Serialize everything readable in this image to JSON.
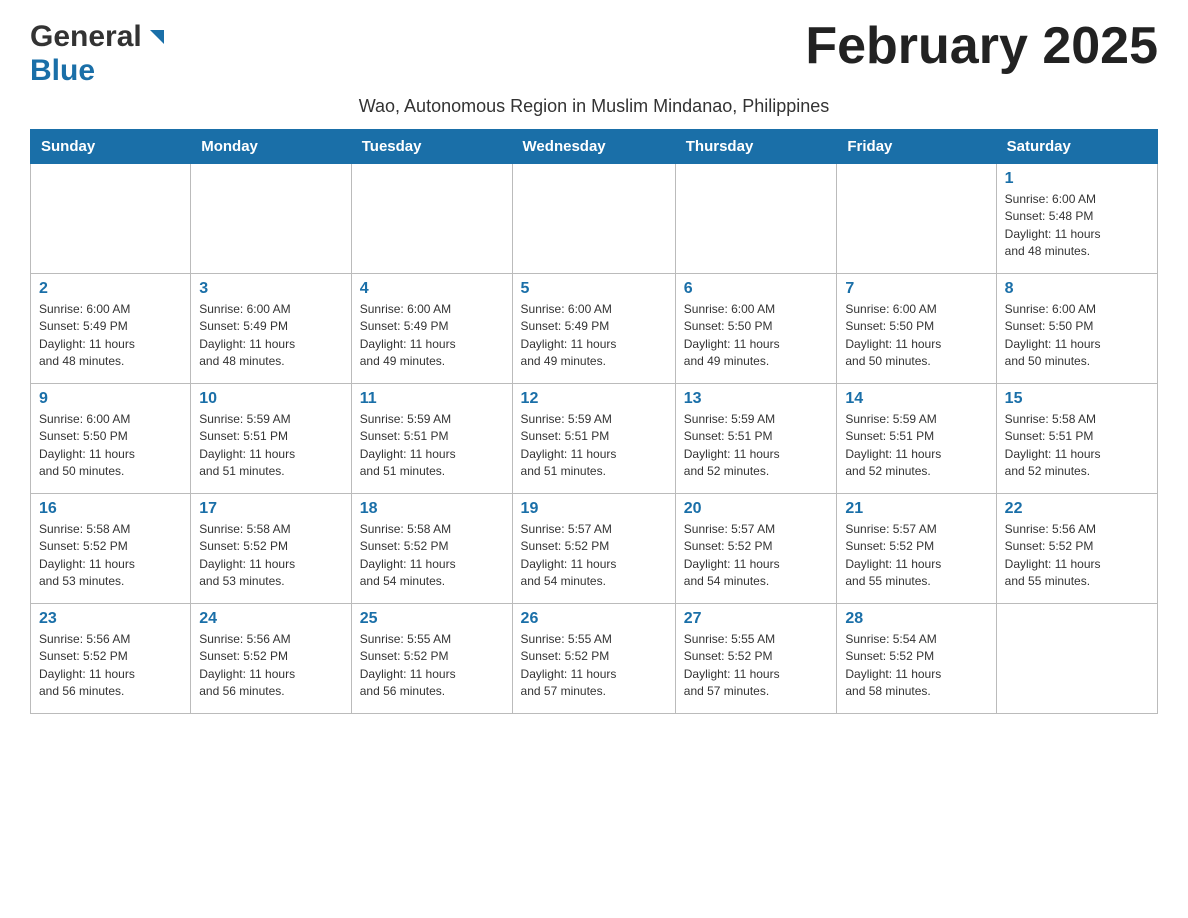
{
  "header": {
    "logo_general": "General",
    "logo_blue": "Blue",
    "month_title": "February 2025",
    "subtitle": "Wao, Autonomous Region in Muslim Mindanao, Philippines"
  },
  "weekdays": [
    "Sunday",
    "Monday",
    "Tuesday",
    "Wednesday",
    "Thursday",
    "Friday",
    "Saturday"
  ],
  "weeks": [
    [
      {
        "day": "",
        "info": ""
      },
      {
        "day": "",
        "info": ""
      },
      {
        "day": "",
        "info": ""
      },
      {
        "day": "",
        "info": ""
      },
      {
        "day": "",
        "info": ""
      },
      {
        "day": "",
        "info": ""
      },
      {
        "day": "1",
        "info": "Sunrise: 6:00 AM\nSunset: 5:48 PM\nDaylight: 11 hours\nand 48 minutes."
      }
    ],
    [
      {
        "day": "2",
        "info": "Sunrise: 6:00 AM\nSunset: 5:49 PM\nDaylight: 11 hours\nand 48 minutes."
      },
      {
        "day": "3",
        "info": "Sunrise: 6:00 AM\nSunset: 5:49 PM\nDaylight: 11 hours\nand 48 minutes."
      },
      {
        "day": "4",
        "info": "Sunrise: 6:00 AM\nSunset: 5:49 PM\nDaylight: 11 hours\nand 49 minutes."
      },
      {
        "day": "5",
        "info": "Sunrise: 6:00 AM\nSunset: 5:49 PM\nDaylight: 11 hours\nand 49 minutes."
      },
      {
        "day": "6",
        "info": "Sunrise: 6:00 AM\nSunset: 5:50 PM\nDaylight: 11 hours\nand 49 minutes."
      },
      {
        "day": "7",
        "info": "Sunrise: 6:00 AM\nSunset: 5:50 PM\nDaylight: 11 hours\nand 50 minutes."
      },
      {
        "day": "8",
        "info": "Sunrise: 6:00 AM\nSunset: 5:50 PM\nDaylight: 11 hours\nand 50 minutes."
      }
    ],
    [
      {
        "day": "9",
        "info": "Sunrise: 6:00 AM\nSunset: 5:50 PM\nDaylight: 11 hours\nand 50 minutes."
      },
      {
        "day": "10",
        "info": "Sunrise: 5:59 AM\nSunset: 5:51 PM\nDaylight: 11 hours\nand 51 minutes."
      },
      {
        "day": "11",
        "info": "Sunrise: 5:59 AM\nSunset: 5:51 PM\nDaylight: 11 hours\nand 51 minutes."
      },
      {
        "day": "12",
        "info": "Sunrise: 5:59 AM\nSunset: 5:51 PM\nDaylight: 11 hours\nand 51 minutes."
      },
      {
        "day": "13",
        "info": "Sunrise: 5:59 AM\nSunset: 5:51 PM\nDaylight: 11 hours\nand 52 minutes."
      },
      {
        "day": "14",
        "info": "Sunrise: 5:59 AM\nSunset: 5:51 PM\nDaylight: 11 hours\nand 52 minutes."
      },
      {
        "day": "15",
        "info": "Sunrise: 5:58 AM\nSunset: 5:51 PM\nDaylight: 11 hours\nand 52 minutes."
      }
    ],
    [
      {
        "day": "16",
        "info": "Sunrise: 5:58 AM\nSunset: 5:52 PM\nDaylight: 11 hours\nand 53 minutes."
      },
      {
        "day": "17",
        "info": "Sunrise: 5:58 AM\nSunset: 5:52 PM\nDaylight: 11 hours\nand 53 minutes."
      },
      {
        "day": "18",
        "info": "Sunrise: 5:58 AM\nSunset: 5:52 PM\nDaylight: 11 hours\nand 54 minutes."
      },
      {
        "day": "19",
        "info": "Sunrise: 5:57 AM\nSunset: 5:52 PM\nDaylight: 11 hours\nand 54 minutes."
      },
      {
        "day": "20",
        "info": "Sunrise: 5:57 AM\nSunset: 5:52 PM\nDaylight: 11 hours\nand 54 minutes."
      },
      {
        "day": "21",
        "info": "Sunrise: 5:57 AM\nSunset: 5:52 PM\nDaylight: 11 hours\nand 55 minutes."
      },
      {
        "day": "22",
        "info": "Sunrise: 5:56 AM\nSunset: 5:52 PM\nDaylight: 11 hours\nand 55 minutes."
      }
    ],
    [
      {
        "day": "23",
        "info": "Sunrise: 5:56 AM\nSunset: 5:52 PM\nDaylight: 11 hours\nand 56 minutes."
      },
      {
        "day": "24",
        "info": "Sunrise: 5:56 AM\nSunset: 5:52 PM\nDaylight: 11 hours\nand 56 minutes."
      },
      {
        "day": "25",
        "info": "Sunrise: 5:55 AM\nSunset: 5:52 PM\nDaylight: 11 hours\nand 56 minutes."
      },
      {
        "day": "26",
        "info": "Sunrise: 5:55 AM\nSunset: 5:52 PM\nDaylight: 11 hours\nand 57 minutes."
      },
      {
        "day": "27",
        "info": "Sunrise: 5:55 AM\nSunset: 5:52 PM\nDaylight: 11 hours\nand 57 minutes."
      },
      {
        "day": "28",
        "info": "Sunrise: 5:54 AM\nSunset: 5:52 PM\nDaylight: 11 hours\nand 58 minutes."
      },
      {
        "day": "",
        "info": ""
      }
    ]
  ]
}
